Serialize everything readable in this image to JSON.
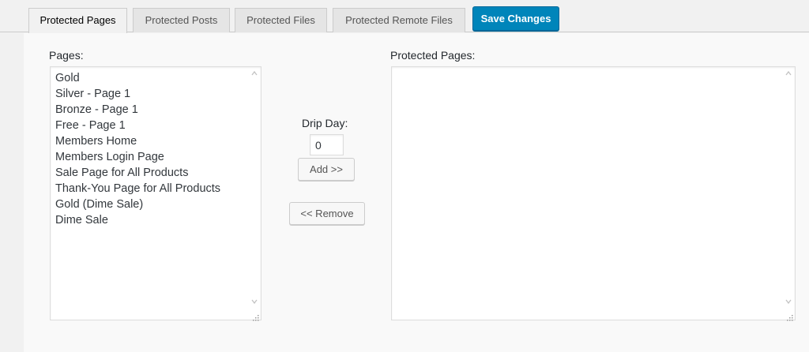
{
  "tabs": [
    {
      "label": "Protected Pages",
      "active": true
    },
    {
      "label": "Protected Posts",
      "active": false
    },
    {
      "label": "Protected Files",
      "active": false
    },
    {
      "label": "Protected Remote Files",
      "active": false
    }
  ],
  "toolbar": {
    "save_label": "Save Changes"
  },
  "pages": {
    "label": "Pages:",
    "items": [
      "Gold",
      "Silver - Page 1",
      "Bronze - Page 1",
      "Free - Page 1",
      "Members Home",
      "Members Login Page",
      "Sale Page for All Products",
      "Thank-You Page for All Products",
      "Gold (Dime Sale)",
      "Dime Sale"
    ]
  },
  "drip": {
    "label": "Drip Day:",
    "value": "0"
  },
  "actions": {
    "add_label": "Add >>",
    "remove_label": "<< Remove"
  },
  "protected": {
    "label": "Protected Pages:",
    "items": []
  },
  "colors": {
    "accent": "#0085ba",
    "background": "#f1f1f1"
  },
  "icons": {
    "scroll_up": "chevron-up-icon",
    "scroll_down": "chevron-down-icon",
    "resize": "resize-grip-icon"
  }
}
